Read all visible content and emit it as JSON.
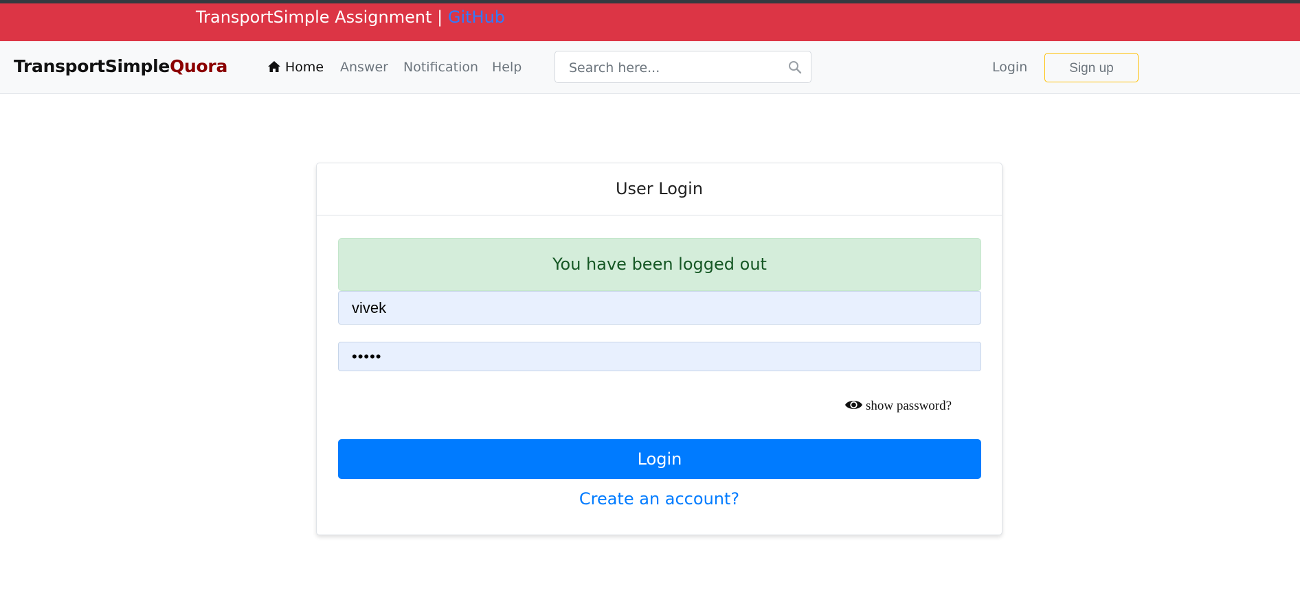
{
  "banner": {
    "title": "TransportSimple Assignment | ",
    "link_label": "GitHub"
  },
  "navbar": {
    "brand_main": "TransportSimple",
    "brand_accent": "Quora",
    "items": [
      {
        "label": "Home",
        "icon": "home-icon",
        "active": true
      },
      {
        "label": "Answer"
      },
      {
        "label": "Notification"
      },
      {
        "label": "Help"
      }
    ],
    "search": {
      "placeholder": "Search here...",
      "value": "",
      "icon": "search-icon"
    },
    "login_label": "Login",
    "signup_label": "Sign up"
  },
  "login_card": {
    "title": "User Login",
    "alert": "You have been logged out",
    "username_value": "vivek",
    "password_value": "vivek",
    "show_password_label": "show password?",
    "show_password_icon": "eye-icon",
    "login_button": "Login",
    "create_account": "Create an account?"
  },
  "colors": {
    "banner": "#dc3545",
    "brand_accent": "#8b0000",
    "primary": "#007bff",
    "alert_bg": "#d4edda",
    "alert_text": "#155724",
    "signup_border": "#ffc107",
    "github_link": "#2f7bff"
  }
}
